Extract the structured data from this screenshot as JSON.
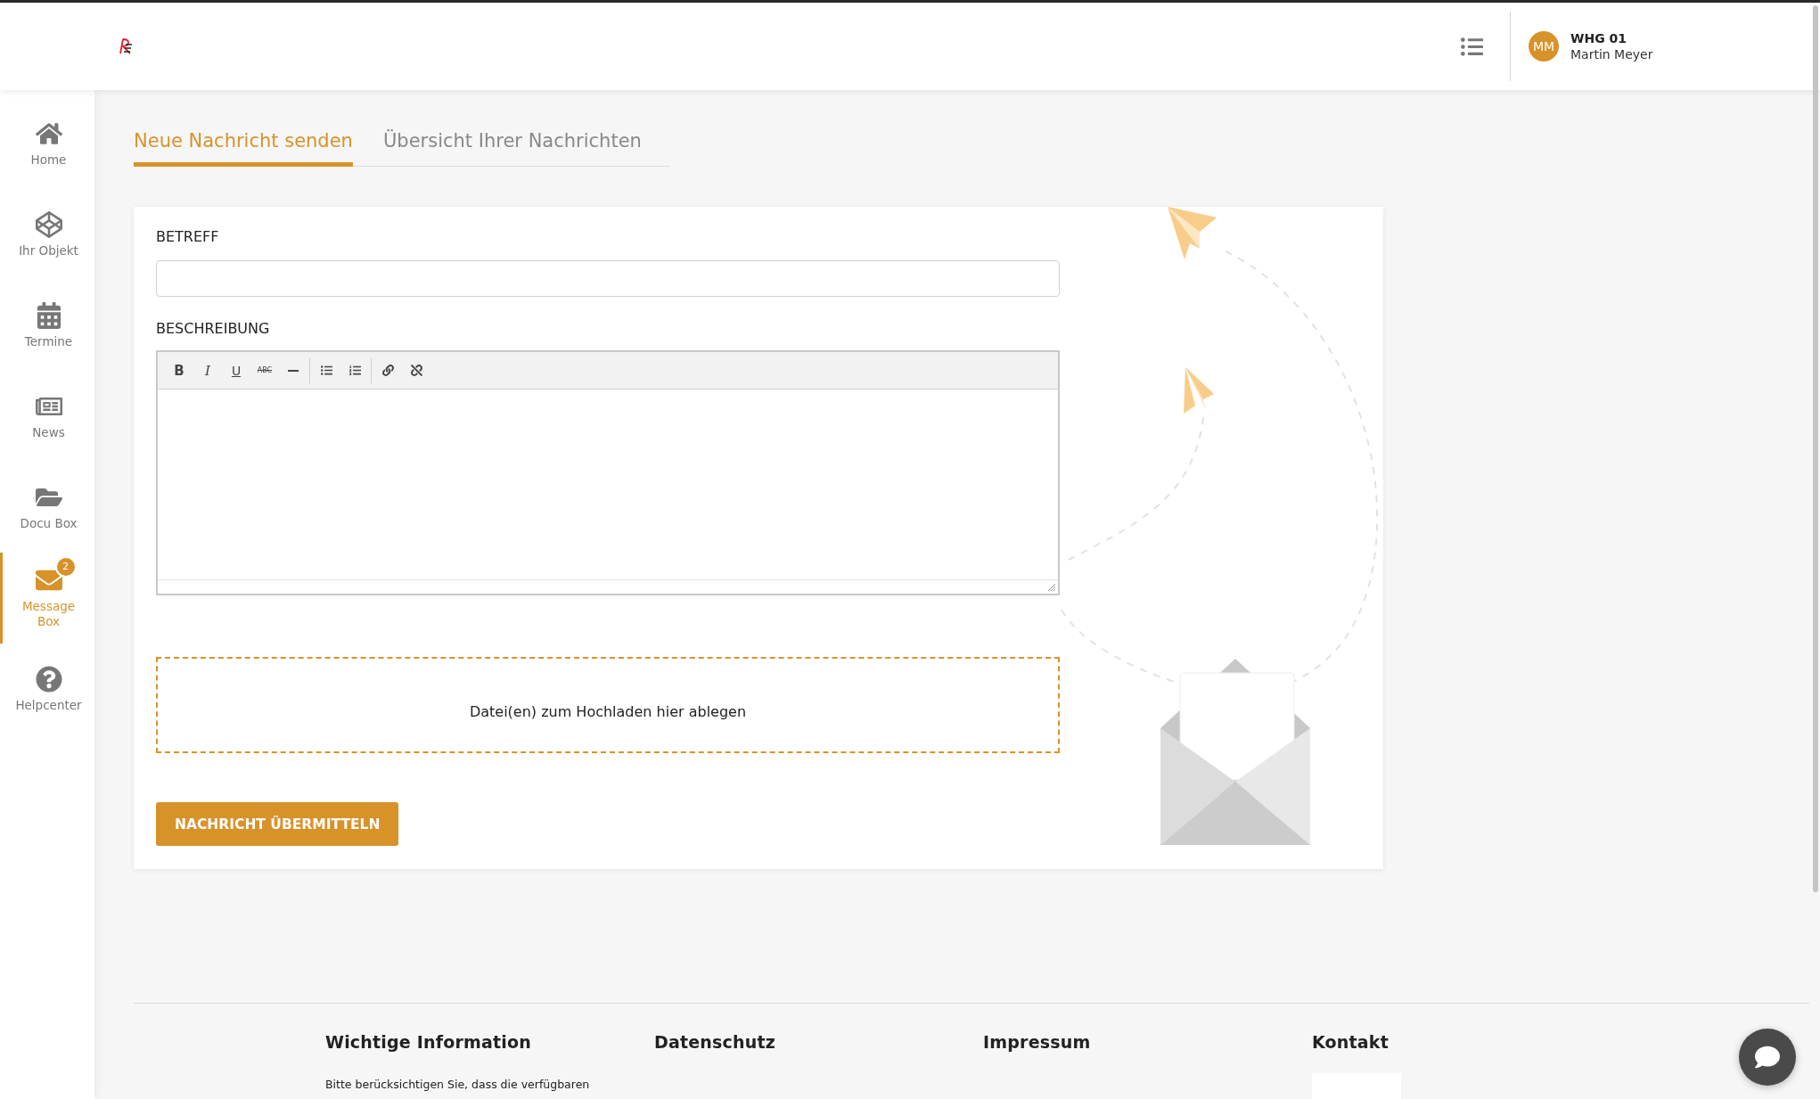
{
  "header": {
    "user": {
      "initials": "MM",
      "unit": "WHG 01",
      "name": "Martin Meyer"
    }
  },
  "sidebar": {
    "items": [
      {
        "label": "Home",
        "kind": "home",
        "selected": false
      },
      {
        "label": "Ihr Objekt",
        "kind": "cube",
        "selected": false
      },
      {
        "label": "Termine",
        "kind": "calendar",
        "selected": false
      },
      {
        "label": "News",
        "kind": "news",
        "selected": false
      },
      {
        "label": "Docu Box",
        "kind": "folder",
        "selected": false
      },
      {
        "label": "Message Box",
        "kind": "mail",
        "selected": true,
        "badge": "2"
      },
      {
        "label": "Helpcenter",
        "kind": "help",
        "selected": false
      }
    ]
  },
  "tabs": [
    {
      "label": "Neue Nachricht senden",
      "selected": true
    },
    {
      "label": "Übersicht Ihrer Nachrichten",
      "selected": false
    }
  ],
  "form": {
    "subject": {
      "label": "BETREFF"
    },
    "description": {
      "label": "BESCHREIBUNG",
      "toolbar": [
        {
          "kind": "bold",
          "label": "B"
        },
        {
          "kind": "italic",
          "label": "I"
        },
        {
          "kind": "underline",
          "label": "U"
        },
        {
          "kind": "strike",
          "label": "ABC"
        },
        {
          "kind": "rule"
        },
        {
          "kind": "bullets"
        },
        {
          "kind": "numbers"
        },
        {
          "kind": "link"
        },
        {
          "kind": "unlink"
        }
      ]
    },
    "dropzone": {
      "text": "Datei(en) zum Hochladen hier ablegen"
    },
    "submit": "NACHRICHT ÜBERMITTELN"
  },
  "footer": {
    "columns": [
      {
        "heading": "Wichtige Information",
        "text": "Bitte berücksichtigen Sie, dass die verfügbaren"
      },
      {
        "heading": "Datenschutz"
      },
      {
        "heading": "Impressum"
      },
      {
        "heading": "Kontakt"
      }
    ]
  }
}
